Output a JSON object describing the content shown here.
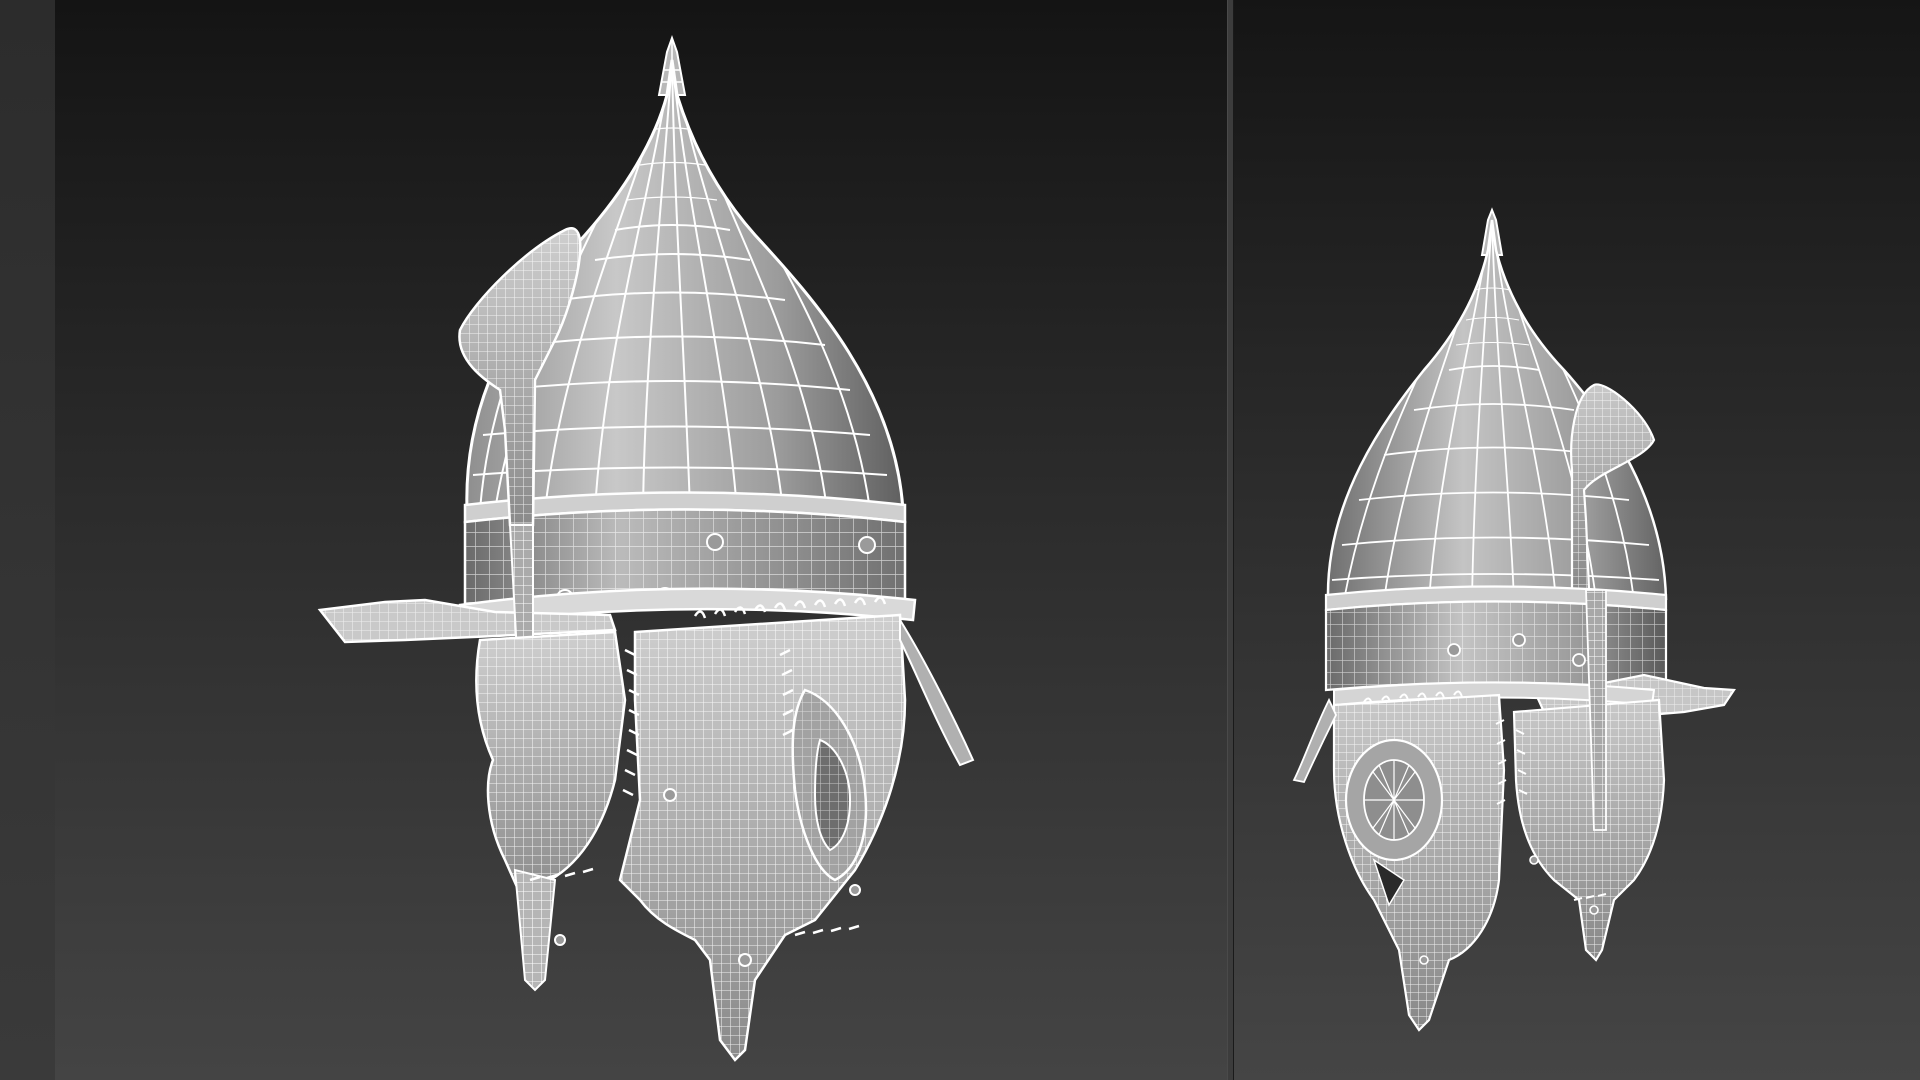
{
  "viewports": [
    {
      "name": "perspective-viewport-front",
      "object": "helmet-wireframe",
      "shading": "wireframe-over-shaded",
      "wire_color": "#ffffff",
      "surface_color": "#9a9a9a"
    },
    {
      "name": "perspective-viewport-back",
      "object": "helmet-wireframe",
      "shading": "wireframe-over-shaded",
      "wire_color": "#ffffff",
      "surface_color": "#9a9a9a"
    }
  ],
  "colors": {
    "background_top": "#141414",
    "background_bottom": "#444444",
    "divider": "#3c3c3c"
  }
}
